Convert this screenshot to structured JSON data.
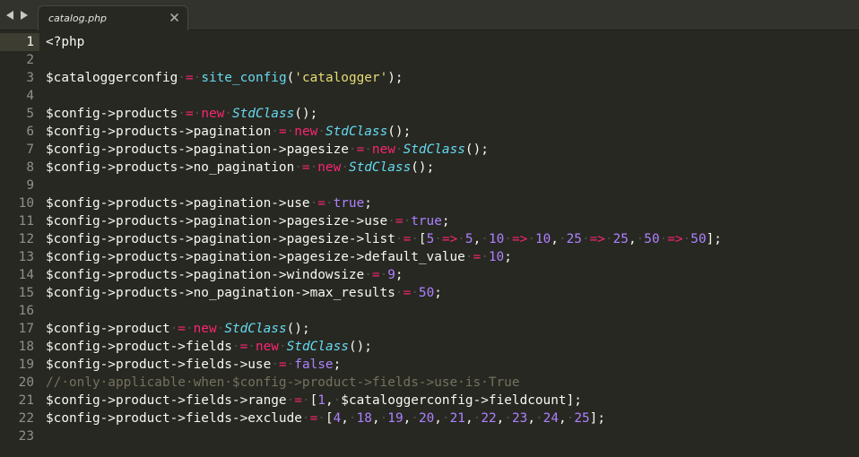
{
  "tabbar": {
    "back_icon": "triangle-left-icon",
    "forward_icon": "triangle-right-icon",
    "tab": {
      "label": "catalog.php",
      "close_icon": "close-icon"
    }
  },
  "colors": {
    "background": "#272822",
    "keyword": "#f92672",
    "function": "#66d9ef",
    "string": "#e6db74",
    "number": "#ae81ff",
    "comment": "#75715e",
    "text": "#f8f8f2"
  },
  "editor": {
    "active_line": 1,
    "lines": [
      {
        "n": "1",
        "tokens": [
          [
            "var",
            "<?php"
          ]
        ]
      },
      {
        "n": "2",
        "tokens": []
      },
      {
        "n": "3",
        "tokens": [
          [
            "var",
            "$cataloggerconfig"
          ],
          [
            "ws",
            "·"
          ],
          [
            "op",
            "="
          ],
          [
            "ws",
            "·"
          ],
          [
            "fn",
            "site_config"
          ],
          [
            "punct",
            "("
          ],
          [
            "str",
            "'catalogger'"
          ],
          [
            "punct",
            ");"
          ]
        ]
      },
      {
        "n": "4",
        "tokens": []
      },
      {
        "n": "5",
        "tokens": [
          [
            "var",
            "$config->products"
          ],
          [
            "ws",
            "·"
          ],
          [
            "op",
            "="
          ],
          [
            "ws",
            "·"
          ],
          [
            "kw",
            "new"
          ],
          [
            "ws",
            "·"
          ],
          [
            "class",
            "StdClass"
          ],
          [
            "punct",
            "();"
          ]
        ]
      },
      {
        "n": "6",
        "tokens": [
          [
            "var",
            "$config->products->pagination"
          ],
          [
            "ws",
            "·"
          ],
          [
            "op",
            "="
          ],
          [
            "ws",
            "·"
          ],
          [
            "kw",
            "new"
          ],
          [
            "ws",
            "·"
          ],
          [
            "class",
            "StdClass"
          ],
          [
            "punct",
            "();"
          ]
        ]
      },
      {
        "n": "7",
        "tokens": [
          [
            "var",
            "$config->products->pagination->pagesize"
          ],
          [
            "ws",
            "·"
          ],
          [
            "op",
            "="
          ],
          [
            "ws",
            "·"
          ],
          [
            "kw",
            "new"
          ],
          [
            "ws",
            "·"
          ],
          [
            "class",
            "StdClass"
          ],
          [
            "punct",
            "();"
          ]
        ]
      },
      {
        "n": "8",
        "tokens": [
          [
            "var",
            "$config->products->no_pagination"
          ],
          [
            "ws",
            "·"
          ],
          [
            "op",
            "="
          ],
          [
            "ws",
            "·"
          ],
          [
            "kw",
            "new"
          ],
          [
            "ws",
            "·"
          ],
          [
            "class",
            "StdClass"
          ],
          [
            "punct",
            "();"
          ]
        ]
      },
      {
        "n": "9",
        "tokens": []
      },
      {
        "n": "10",
        "tokens": [
          [
            "var",
            "$config->products->pagination->use"
          ],
          [
            "ws",
            "·"
          ],
          [
            "op",
            "="
          ],
          [
            "ws",
            "·"
          ],
          [
            "const",
            "true"
          ],
          [
            "punct",
            ";"
          ]
        ]
      },
      {
        "n": "11",
        "tokens": [
          [
            "var",
            "$config->products->pagination->pagesize->use"
          ],
          [
            "ws",
            "·"
          ],
          [
            "op",
            "="
          ],
          [
            "ws",
            "·"
          ],
          [
            "const",
            "true"
          ],
          [
            "punct",
            ";"
          ]
        ]
      },
      {
        "n": "12",
        "tokens": [
          [
            "var",
            "$config->products->pagination->pagesize->list"
          ],
          [
            "ws",
            "·"
          ],
          [
            "op",
            "="
          ],
          [
            "ws",
            "·"
          ],
          [
            "punct",
            "["
          ],
          [
            "num",
            "5"
          ],
          [
            "ws",
            "·"
          ],
          [
            "op",
            "=>"
          ],
          [
            "ws",
            "·"
          ],
          [
            "num",
            "5"
          ],
          [
            "punct",
            ","
          ],
          [
            "ws",
            "·"
          ],
          [
            "num",
            "10"
          ],
          [
            "ws",
            "·"
          ],
          [
            "op",
            "=>"
          ],
          [
            "ws",
            "·"
          ],
          [
            "num",
            "10"
          ],
          [
            "punct",
            ","
          ],
          [
            "ws",
            "·"
          ],
          [
            "num",
            "25"
          ],
          [
            "ws",
            "·"
          ],
          [
            "op",
            "=>"
          ],
          [
            "ws",
            "·"
          ],
          [
            "num",
            "25"
          ],
          [
            "punct",
            ","
          ],
          [
            "ws",
            "·"
          ],
          [
            "num",
            "50"
          ],
          [
            "ws",
            "·"
          ],
          [
            "op",
            "=>"
          ],
          [
            "ws",
            "·"
          ],
          [
            "num",
            "50"
          ],
          [
            "punct",
            "];"
          ]
        ]
      },
      {
        "n": "13",
        "tokens": [
          [
            "var",
            "$config->products->pagination->pagesize->default_value"
          ],
          [
            "ws",
            "·"
          ],
          [
            "op",
            "="
          ],
          [
            "ws",
            "·"
          ],
          [
            "num",
            "10"
          ],
          [
            "punct",
            ";"
          ]
        ]
      },
      {
        "n": "14",
        "tokens": [
          [
            "var",
            "$config->products->pagination->windowsize"
          ],
          [
            "ws",
            "·"
          ],
          [
            "op",
            "="
          ],
          [
            "ws",
            "·"
          ],
          [
            "num",
            "9"
          ],
          [
            "punct",
            ";"
          ]
        ]
      },
      {
        "n": "15",
        "tokens": [
          [
            "var",
            "$config->products->no_pagination->max_results"
          ],
          [
            "ws",
            "·"
          ],
          [
            "op",
            "="
          ],
          [
            "ws",
            "·"
          ],
          [
            "num",
            "50"
          ],
          [
            "punct",
            ";"
          ]
        ]
      },
      {
        "n": "16",
        "tokens": []
      },
      {
        "n": "17",
        "tokens": [
          [
            "var",
            "$config->product"
          ],
          [
            "ws",
            "·"
          ],
          [
            "op",
            "="
          ],
          [
            "ws",
            "·"
          ],
          [
            "kw",
            "new"
          ],
          [
            "ws",
            "·"
          ],
          [
            "class",
            "StdClass"
          ],
          [
            "punct",
            "();"
          ]
        ]
      },
      {
        "n": "18",
        "tokens": [
          [
            "var",
            "$config->product->fields"
          ],
          [
            "ws",
            "·"
          ],
          [
            "op",
            "="
          ],
          [
            "ws",
            "·"
          ],
          [
            "kw",
            "new"
          ],
          [
            "ws",
            "·"
          ],
          [
            "class",
            "StdClass"
          ],
          [
            "punct",
            "();"
          ]
        ]
      },
      {
        "n": "19",
        "tokens": [
          [
            "var",
            "$config->product->fields->use"
          ],
          [
            "ws",
            "·"
          ],
          [
            "op",
            "="
          ],
          [
            "ws",
            "·"
          ],
          [
            "const",
            "false"
          ],
          [
            "punct",
            ";"
          ]
        ]
      },
      {
        "n": "20",
        "tokens": [
          [
            "comment",
            "//·only·applicable·when·$config->product->fields->use·is·True"
          ]
        ]
      },
      {
        "n": "21",
        "tokens": [
          [
            "var",
            "$config->product->fields->range"
          ],
          [
            "ws",
            "·"
          ],
          [
            "op",
            "="
          ],
          [
            "ws",
            "·"
          ],
          [
            "punct",
            "["
          ],
          [
            "num",
            "1"
          ],
          [
            "punct",
            ","
          ],
          [
            "ws",
            "·"
          ],
          [
            "var",
            "$cataloggerconfig->fieldcount"
          ],
          [
            "punct",
            "];"
          ]
        ]
      },
      {
        "n": "22",
        "tokens": [
          [
            "var",
            "$config->product->fields->exclude"
          ],
          [
            "ws",
            "·"
          ],
          [
            "op",
            "="
          ],
          [
            "ws",
            "·"
          ],
          [
            "punct",
            "["
          ],
          [
            "num",
            "4"
          ],
          [
            "punct",
            ","
          ],
          [
            "ws",
            "·"
          ],
          [
            "num",
            "18"
          ],
          [
            "punct",
            ","
          ],
          [
            "ws",
            "·"
          ],
          [
            "num",
            "19"
          ],
          [
            "punct",
            ","
          ],
          [
            "ws",
            "·"
          ],
          [
            "num",
            "20"
          ],
          [
            "punct",
            ","
          ],
          [
            "ws",
            "·"
          ],
          [
            "num",
            "21"
          ],
          [
            "punct",
            ","
          ],
          [
            "ws",
            "·"
          ],
          [
            "num",
            "22"
          ],
          [
            "punct",
            ","
          ],
          [
            "ws",
            "·"
          ],
          [
            "num",
            "23"
          ],
          [
            "punct",
            ","
          ],
          [
            "ws",
            "·"
          ],
          [
            "num",
            "24"
          ],
          [
            "punct",
            ","
          ],
          [
            "ws",
            "·"
          ],
          [
            "num",
            "25"
          ],
          [
            "punct",
            "];"
          ]
        ]
      },
      {
        "n": "23",
        "tokens": []
      }
    ]
  }
}
